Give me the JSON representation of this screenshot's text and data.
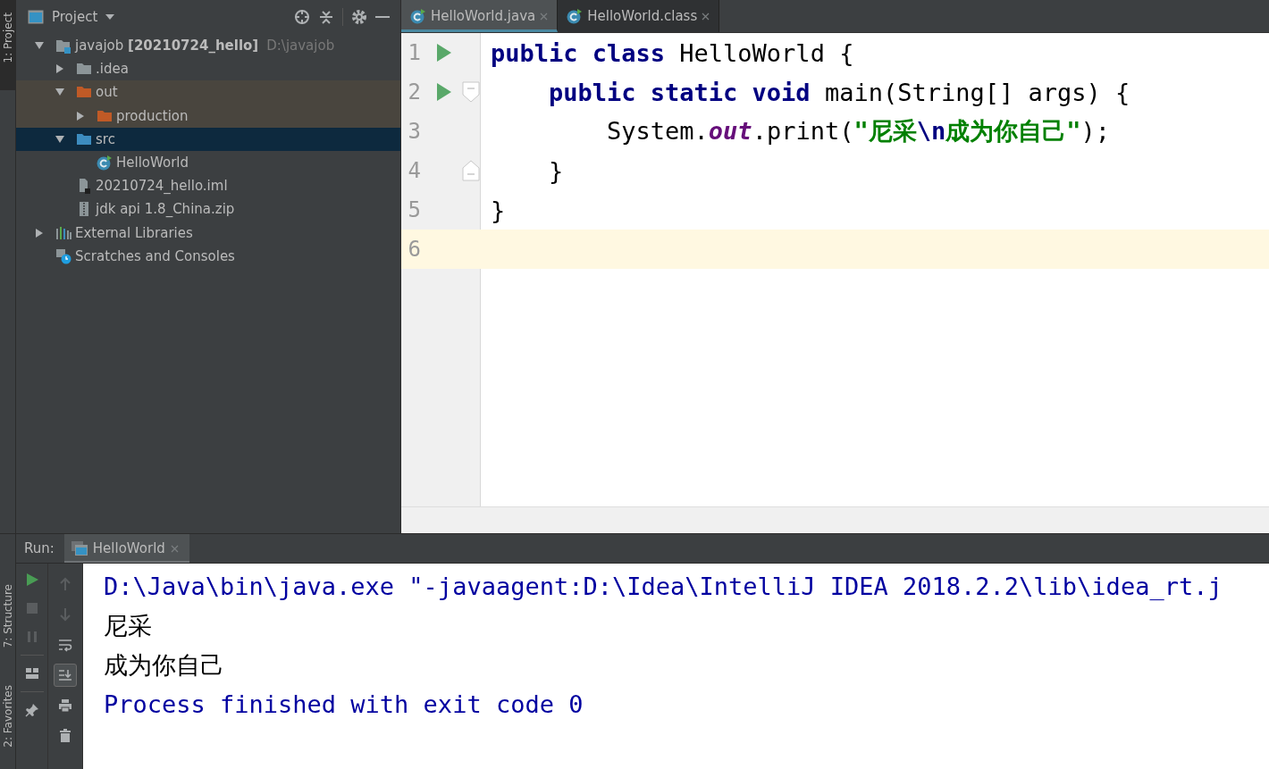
{
  "side_stripe": {
    "top": [
      {
        "label": "1: Project",
        "selected": true
      }
    ],
    "bottom": [
      {
        "label": "7: Structure",
        "selected": false
      },
      {
        "label": "2: Favorites",
        "selected": false
      }
    ]
  },
  "project_panel": {
    "title": "Project",
    "tree": [
      {
        "kind": "module",
        "label": "javajob **[20210724_hello]**",
        "path": "D:\\javajob",
        "expanded": true,
        "selected": false,
        "children": [
          {
            "kind": "folder",
            "label": ".idea",
            "expanded": false,
            "selected": false
          },
          {
            "kind": "excluded-folder",
            "label": "out",
            "expanded": true,
            "selected": false,
            "children": [
              {
                "kind": "excluded-folder",
                "label": "production",
                "expanded": false,
                "selected": false
              }
            ]
          },
          {
            "kind": "source-folder",
            "label": "src",
            "expanded": true,
            "selected": true,
            "children": [
              {
                "kind": "class",
                "label": "HelloWorld",
                "selected": false
              }
            ]
          },
          {
            "kind": "iml",
            "label": "20210724_hello.iml",
            "selected": false
          },
          {
            "kind": "zip",
            "label": "jdk api 1.8_China.zip",
            "selected": false
          }
        ]
      },
      {
        "kind": "libraries",
        "label": "External Libraries",
        "expanded": false,
        "selected": false
      },
      {
        "kind": "scratches",
        "label": "Scratches and Consoles",
        "selected": false
      }
    ]
  },
  "editor": {
    "tabs": [
      {
        "label": "HelloWorld.java",
        "selected": true
      },
      {
        "label": "HelloWorld.class",
        "selected": false
      }
    ],
    "lines": [
      {
        "number": "1",
        "run_marker": true,
        "current": false,
        "tokens": [
          {
            "kind": "keyword",
            "text": "public class "
          },
          {
            "kind": "plain",
            "text": "HelloWorld {"
          }
        ]
      },
      {
        "number": "2",
        "run_marker": true,
        "fold_start": true,
        "current": false,
        "tokens": [
          {
            "kind": "keyword",
            "text": "    public static void "
          },
          {
            "kind": "plain",
            "text": "main(String[] args) {"
          }
        ]
      },
      {
        "number": "3",
        "run_marker": false,
        "current": false,
        "tokens": [
          {
            "kind": "plain",
            "text": "        System."
          },
          {
            "kind": "field",
            "text": "out"
          },
          {
            "kind": "plain",
            "text": ".print("
          },
          {
            "kind": "string",
            "text": "\"尼采"
          },
          {
            "kind": "escape",
            "text": "\\n"
          },
          {
            "kind": "string",
            "text": "成为你自己\""
          },
          {
            "kind": "plain",
            "text": ");"
          }
        ]
      },
      {
        "number": "4",
        "run_marker": false,
        "fold_end": true,
        "current": false,
        "tokens": [
          {
            "kind": "plain",
            "text": "    }"
          }
        ]
      },
      {
        "number": "5",
        "run_marker": false,
        "current": false,
        "tokens": [
          {
            "kind": "plain",
            "text": "}"
          }
        ]
      },
      {
        "number": "6",
        "run_marker": false,
        "current": true
      }
    ]
  },
  "run_panel": {
    "label": "Run:",
    "tabs": [
      {
        "label": "HelloWorld",
        "selected": true
      }
    ],
    "toolbar_left": [
      {
        "kind": "run"
      },
      {
        "kind": "stop"
      },
      {
        "kind": "pause"
      },
      {
        "kind": "separator"
      },
      {
        "kind": "layout"
      },
      {
        "kind": "separator"
      },
      {
        "kind": "pin"
      }
    ],
    "toolbar_right": [
      {
        "kind": "up",
        "selected": false
      },
      {
        "kind": "down",
        "selected": false
      },
      {
        "kind": "wrap",
        "selected": false
      },
      {
        "kind": "scroll-end",
        "selected": true
      },
      {
        "kind": "print",
        "selected": false
      },
      {
        "kind": "trash",
        "selected": false
      }
    ],
    "console": [
      {
        "kind": "command",
        "text": "D:\\Java\\bin\\java.exe \"-javaagent:D:\\Idea\\IntelliJ IDEA 2018.2.2\\lib\\idea_rt.j"
      },
      {
        "kind": "output",
        "text": "尼采"
      },
      {
        "kind": "output",
        "text": "成为你自己"
      },
      {
        "kind": "exit",
        "text": "Process finished with exit code 0"
      }
    ]
  }
}
